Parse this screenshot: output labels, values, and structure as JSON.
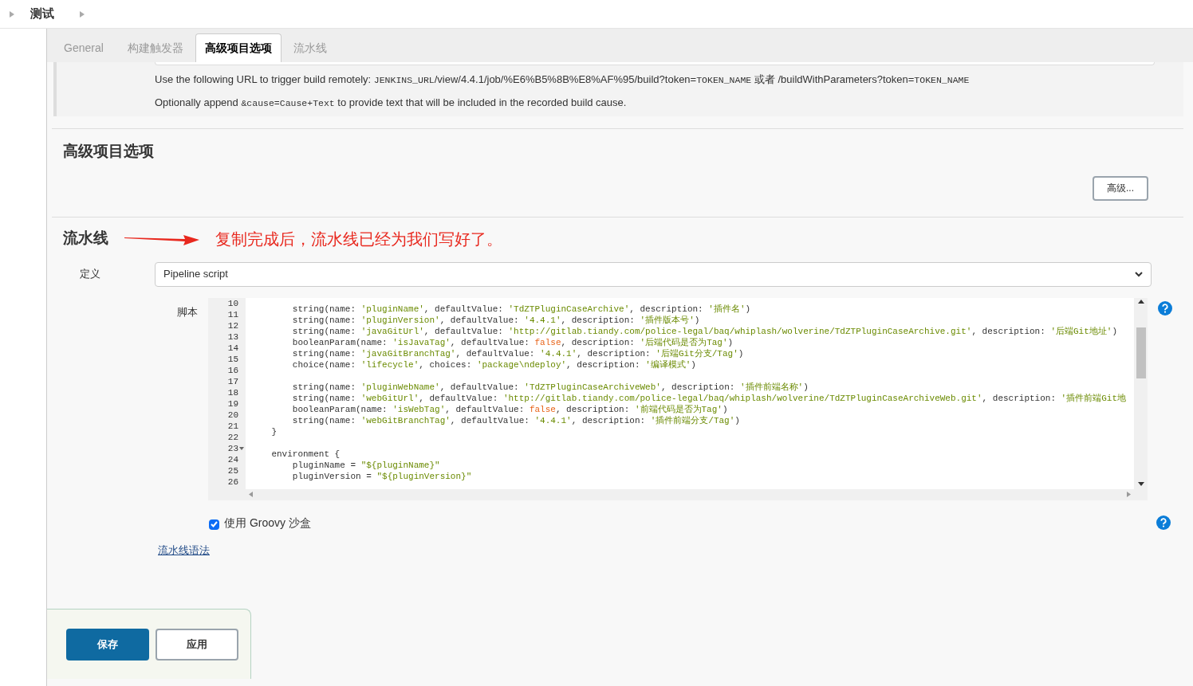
{
  "breadcrumb": {
    "items": [
      "测试"
    ]
  },
  "tabs": [
    {
      "label": "General",
      "selected": false
    },
    {
      "label": "构建触发器",
      "selected": false
    },
    {
      "label": "高级项目选项",
      "selected": true
    },
    {
      "label": "流水线",
      "selected": false
    }
  ],
  "trigger_help": {
    "line1": [
      {
        "t": "Use the following URL to trigger build remotely: ",
        "kind": "text"
      },
      {
        "t": "JENKINS_URL",
        "kind": "code"
      },
      {
        "t": "/view/4.4.1/job/%E6%B5%8B%E8%AF%95/build?token=",
        "kind": "text"
      },
      {
        "t": "TOKEN_NAME",
        "kind": "code"
      },
      {
        "t": " 或者 /buildWithParameters?token=",
        "kind": "text"
      },
      {
        "t": "TOKEN_NAME",
        "kind": "code"
      }
    ],
    "line2": [
      {
        "t": "Optionally append ",
        "kind": "text"
      },
      {
        "t": "&cause=Cause+Text",
        "kind": "code"
      },
      {
        "t": " to provide text that will be included in the recorded build cause.",
        "kind": "text"
      }
    ]
  },
  "advanced_section": {
    "title": "高级项目选项",
    "button": "高级..."
  },
  "pipeline_section": {
    "title": "流水线",
    "annotation": "复制完成后，流水线已经为我们写好了。",
    "definition_label": "定义",
    "definition_value": "Pipeline script",
    "script_label": "脚本",
    "code_lines": [
      {
        "number": "10",
        "segments": [
          {
            "t": "        string(name: ",
            "kind": "plain"
          },
          {
            "t": "'pluginName'",
            "kind": "string"
          },
          {
            "t": ", defaultValue: ",
            "kind": "plain"
          },
          {
            "t": "'TdZTPluginCaseArchive'",
            "kind": "string"
          },
          {
            "t": ", description: ",
            "kind": "plain"
          },
          {
            "t": "'插件名'",
            "kind": "string"
          },
          {
            "t": ")",
            "kind": "plain"
          }
        ]
      },
      {
        "number": "11",
        "segments": [
          {
            "t": "        string(name: ",
            "kind": "plain"
          },
          {
            "t": "'pluginVersion'",
            "kind": "string"
          },
          {
            "t": ", defaultValue: ",
            "kind": "plain"
          },
          {
            "t": "'4.4.1'",
            "kind": "string"
          },
          {
            "t": ", description: ",
            "kind": "plain"
          },
          {
            "t": "'插件版本号'",
            "kind": "string"
          },
          {
            "t": ")",
            "kind": "plain"
          }
        ]
      },
      {
        "number": "12",
        "segments": [
          {
            "t": "        string(name: ",
            "kind": "plain"
          },
          {
            "t": "'javaGitUrl'",
            "kind": "string"
          },
          {
            "t": ", defaultValue: ",
            "kind": "plain"
          },
          {
            "t": "'http://gitlab.tiandy.com/police-legal/baq/whiplash/wolverine/TdZTPluginCaseArchive.git'",
            "kind": "string"
          },
          {
            "t": ", description: ",
            "kind": "plain"
          },
          {
            "t": "'后端Git地址'",
            "kind": "string"
          },
          {
            "t": ")",
            "kind": "plain"
          }
        ]
      },
      {
        "number": "13",
        "segments": [
          {
            "t": "        booleanParam(name: ",
            "kind": "plain"
          },
          {
            "t": "'isJavaTag'",
            "kind": "string"
          },
          {
            "t": ", defaultValue: ",
            "kind": "plain"
          },
          {
            "t": "false",
            "kind": "keyword"
          },
          {
            "t": ", description: ",
            "kind": "plain"
          },
          {
            "t": "'后端代码是否为Tag'",
            "kind": "string"
          },
          {
            "t": ")",
            "kind": "plain"
          }
        ]
      },
      {
        "number": "14",
        "segments": [
          {
            "t": "        string(name: ",
            "kind": "plain"
          },
          {
            "t": "'javaGitBranchTag'",
            "kind": "string"
          },
          {
            "t": ", defaultValue: ",
            "kind": "plain"
          },
          {
            "t": "'4.4.1'",
            "kind": "string"
          },
          {
            "t": ", description: ",
            "kind": "plain"
          },
          {
            "t": "'后端Git分支/Tag'",
            "kind": "string"
          },
          {
            "t": ")",
            "kind": "plain"
          }
        ]
      },
      {
        "number": "15",
        "segments": [
          {
            "t": "        choice(name: ",
            "kind": "plain"
          },
          {
            "t": "'lifecycle'",
            "kind": "string"
          },
          {
            "t": ", choices: ",
            "kind": "plain"
          },
          {
            "t": "'package\\ndeploy'",
            "kind": "string"
          },
          {
            "t": ", description: ",
            "kind": "plain"
          },
          {
            "t": "'编译模式'",
            "kind": "string"
          },
          {
            "t": ")",
            "kind": "plain"
          }
        ]
      },
      {
        "number": "16"
      },
      {
        "number": "17",
        "segments": [
          {
            "t": "        string(name: ",
            "kind": "plain"
          },
          {
            "t": "'pluginWebName'",
            "kind": "string"
          },
          {
            "t": ", defaultValue: ",
            "kind": "plain"
          },
          {
            "t": "'TdZTPluginCaseArchiveWeb'",
            "kind": "string"
          },
          {
            "t": ", description: ",
            "kind": "plain"
          },
          {
            "t": "'插件前端名称'",
            "kind": "string"
          },
          {
            "t": ")",
            "kind": "plain"
          }
        ]
      },
      {
        "number": "18",
        "segments": [
          {
            "t": "        string(name: ",
            "kind": "plain"
          },
          {
            "t": "'webGitUrl'",
            "kind": "string"
          },
          {
            "t": ", defaultValue: ",
            "kind": "plain"
          },
          {
            "t": "'http://gitlab.tiandy.com/police-legal/baq/whiplash/wolverine/TdZTPluginCaseArchiveWeb.git'",
            "kind": "string"
          },
          {
            "t": ", description: ",
            "kind": "plain"
          },
          {
            "t": "'插件前端Git地",
            "kind": "string"
          }
        ]
      },
      {
        "number": "19",
        "segments": [
          {
            "t": "        booleanParam(name: ",
            "kind": "plain"
          },
          {
            "t": "'isWebTag'",
            "kind": "string"
          },
          {
            "t": ", defaultValue: ",
            "kind": "plain"
          },
          {
            "t": "false",
            "kind": "keyword"
          },
          {
            "t": ", description: ",
            "kind": "plain"
          },
          {
            "t": "'前端代码是否为Tag'",
            "kind": "string"
          },
          {
            "t": ")",
            "kind": "plain"
          }
        ]
      },
      {
        "number": "20",
        "segments": [
          {
            "t": "        string(name: ",
            "kind": "plain"
          },
          {
            "t": "'webGitBranchTag'",
            "kind": "string"
          },
          {
            "t": ", defaultValue: ",
            "kind": "plain"
          },
          {
            "t": "'4.4.1'",
            "kind": "string"
          },
          {
            "t": ", description: ",
            "kind": "plain"
          },
          {
            "t": "'插件前端分支/Tag'",
            "kind": "string"
          },
          {
            "t": ")",
            "kind": "plain"
          }
        ]
      },
      {
        "number": "21",
        "segments": [
          {
            "t": "    }",
            "kind": "plain"
          }
        ]
      },
      {
        "number": "22"
      },
      {
        "number": "23",
        "foldable": true,
        "segments": [
          {
            "t": "    environment {",
            "kind": "plain"
          }
        ]
      },
      {
        "number": "24",
        "segments": [
          {
            "t": "        pluginName = ",
            "kind": "plain"
          },
          {
            "t": "\"${pluginName}\"",
            "kind": "string"
          }
        ]
      },
      {
        "number": "25",
        "segments": [
          {
            "t": "        pluginVersion = ",
            "kind": "plain"
          },
          {
            "t": "\"${pluginVersion}\"",
            "kind": "string"
          }
        ]
      },
      {
        "number": "26"
      }
    ],
    "sandbox": {
      "label": "使用 Groovy 沙盒",
      "checked": true
    },
    "syntax_link": "流水线语法"
  },
  "buttons": [
    {
      "label": "保存",
      "kind": "primary"
    },
    {
      "label": "应用",
      "kind": "secondary"
    }
  ]
}
